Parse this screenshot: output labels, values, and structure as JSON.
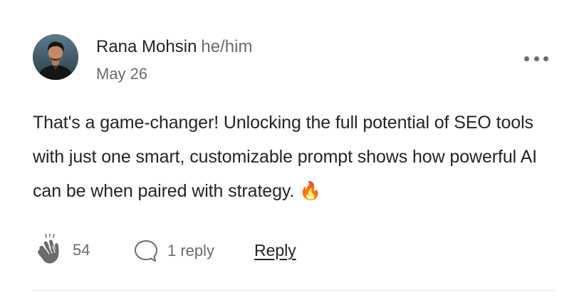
{
  "comment": {
    "author": {
      "name": "Rana Mohsin",
      "pronouns": "he/him",
      "avatar_icon": "profile-photo"
    },
    "date": "May 26",
    "more_icon": "ellipsis-icon",
    "text": "That's a game-changer! Unlocking the full potential of SEO tools with just one smart, customizable prompt shows how powerful AI can be when paired with strategy. 🔥",
    "claps": {
      "icon": "clap-icon",
      "count": "54"
    },
    "replies": {
      "icon": "speech-bubble-icon",
      "label": "1 reply"
    },
    "reply_button_label": "Reply"
  },
  "colors": {
    "text_primary": "#242424",
    "text_secondary": "#6b6b6b",
    "divider": "#e6e6e6"
  }
}
